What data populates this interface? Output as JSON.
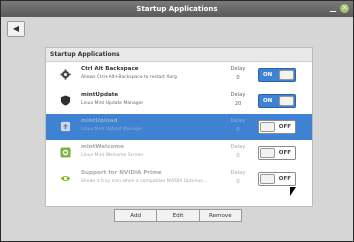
{
  "window": {
    "title": "Startup Applications"
  },
  "toolbar": {
    "back_icon": "back-arrow-icon"
  },
  "panel": {
    "header": "Startup Applications"
  },
  "rows": [
    {
      "name": "Ctrl Alt Backspace",
      "desc": "Allows Ctrl+Alt+Backspace to restart Xorg",
      "delay_label": "Delay",
      "delay": "0",
      "toggle": "ON",
      "state": "on"
    },
    {
      "name": "mintUpdate",
      "desc": "Linux Mint Update Manager",
      "delay_label": "Delay",
      "delay": "20",
      "toggle": "ON",
      "state": "on"
    },
    {
      "name": "mintUpload",
      "desc": "Linux Mint Upload Manager",
      "delay_label": "Delay",
      "delay": "0",
      "toggle": "OFF",
      "state": "off"
    },
    {
      "name": "mintWelcome",
      "desc": "Linux Mint Welcome Screen",
      "delay_label": "Delay",
      "delay": "0",
      "toggle": "OFF",
      "state": "off"
    },
    {
      "name": "Support for NVIDIA Prime",
      "desc": "Shows a tray icon when a compatible NVIDIA Optimus...",
      "delay_label": "Delay",
      "delay": "0",
      "toggle": "OFF",
      "state": "off"
    }
  ],
  "footer": {
    "add": "Add",
    "edit": "Edit",
    "remove": "Remove"
  },
  "colors": {
    "selected": "#3f82d1",
    "window_bg": "#d6d6d6"
  }
}
